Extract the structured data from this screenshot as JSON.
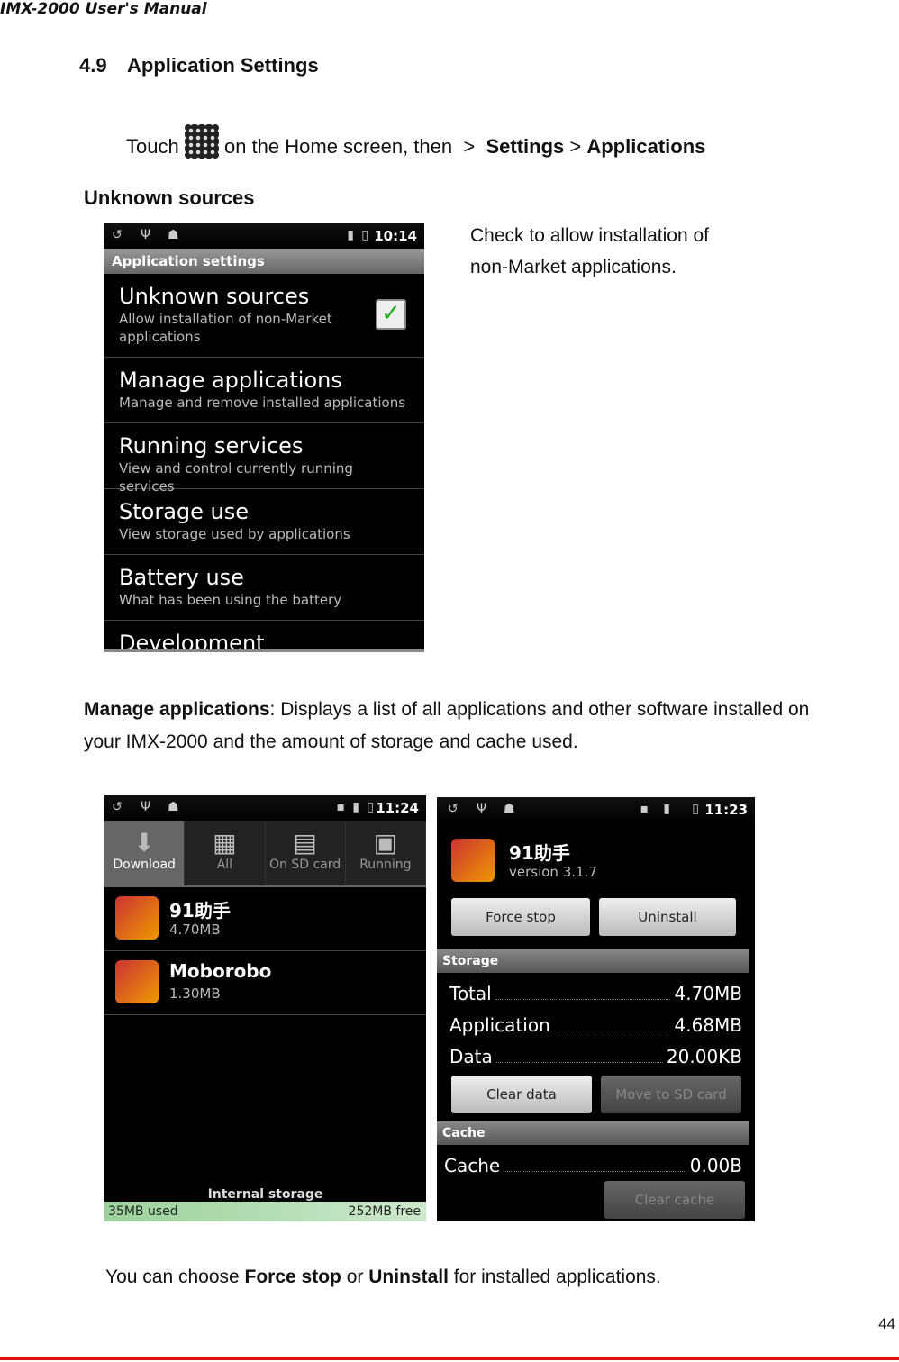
{
  "header": {
    "manual_title": "IMX-2000 User's Manual"
  },
  "section": {
    "number": "4.9",
    "title": "Application Settings"
  },
  "intro": {
    "touch": "Touch",
    "rest": "on the Home screen, then",
    "sep1": ">",
    "settings": "Settings",
    "sep2": ">",
    "applications": "Applications"
  },
  "unknown": {
    "heading": "Unknown sources",
    "desc1": "Check to allow installation of",
    "desc2": "non-Market applications."
  },
  "screen1": {
    "time": "10:14",
    "title": "Application settings",
    "items": [
      {
        "title": "Unknown sources",
        "sub1": "Allow installation of non-Market",
        "sub2": "applications"
      },
      {
        "title": "Manage applications",
        "sub1": "Manage and remove installed applications"
      },
      {
        "title": "Running services",
        "sub1": "View and control currently running services"
      },
      {
        "title": "Storage use",
        "sub1": "View storage used by applications"
      },
      {
        "title": "Battery use",
        "sub1": "What has been using the battery"
      },
      {
        "title": "Development"
      }
    ]
  },
  "manage": {
    "bold": "Manage applications",
    "text": ": Displays a list of all applications and other software installed on",
    "text2": "your IMX-2000 and the amount of storage and cache used."
  },
  "screen2": {
    "time": "11:24",
    "tabs": [
      "Download",
      "All",
      "On SD card",
      "Running"
    ],
    "apps": [
      {
        "name": "91助手",
        "size": "4.70MB"
      },
      {
        "name": "Moborobo",
        "size": "1.30MB"
      }
    ],
    "storage_label": "Internal storage",
    "used": "35MB used",
    "free": "252MB free"
  },
  "screen3": {
    "time": "11:23",
    "app_name": "91助手",
    "version": "version 3.1.7",
    "force_stop": "Force stop",
    "uninstall": "Uninstall",
    "storage_hdr": "Storage",
    "rows": [
      {
        "label": "Total",
        "value": "4.70MB"
      },
      {
        "label": "Application",
        "value": "4.68MB"
      },
      {
        "label": "Data",
        "value": "20.00KB"
      }
    ],
    "clear_data": "Clear data",
    "move_sd": "Move to SD card",
    "cache_hdr": "Cache",
    "cache_label": "Cache",
    "cache_value": "0.00B",
    "clear_cache": "Clear cache"
  },
  "footer": {
    "pre": "You can choose",
    "force": "Force stop",
    "or": "or",
    "uninstall": "Uninstall",
    "post": "for installed applications.",
    "page": "44"
  },
  "colors": {
    "rule": "#e01010",
    "check": "#22aa22"
  }
}
